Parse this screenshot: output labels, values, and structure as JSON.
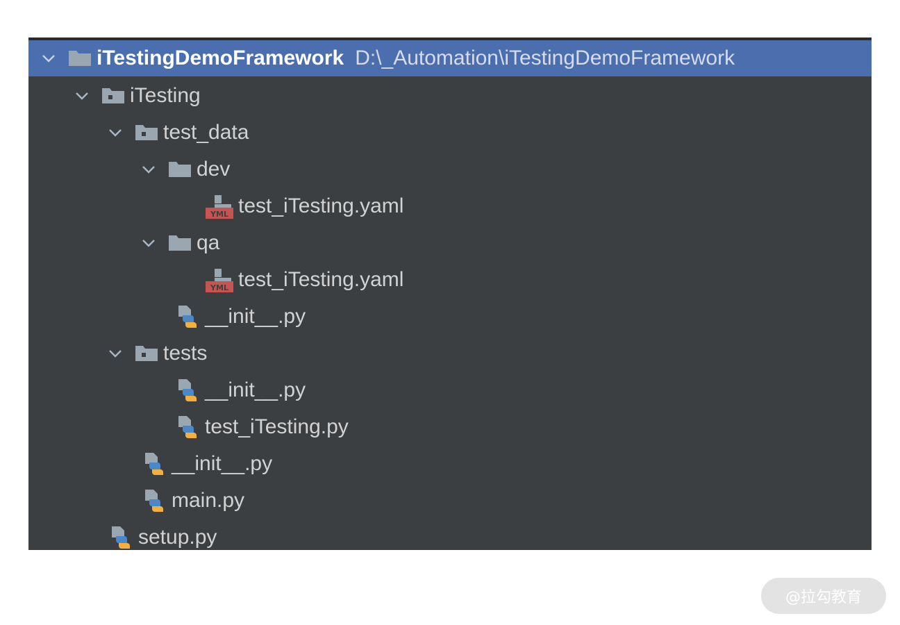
{
  "tree": {
    "root": {
      "label": "iTestingDemoFramework",
      "path": "D:\\_Automation\\iTestingDemoFramework"
    },
    "itesting": {
      "label": "iTesting"
    },
    "test_data": {
      "label": "test_data"
    },
    "dev": {
      "label": "dev"
    },
    "dev_yaml": {
      "label": "test_iTesting.yaml"
    },
    "qa": {
      "label": "qa"
    },
    "qa_yaml": {
      "label": "test_iTesting.yaml"
    },
    "test_data_init": {
      "label": "__init__.py"
    },
    "tests": {
      "label": "tests"
    },
    "tests_init": {
      "label": "__init__.py"
    },
    "tests_file": {
      "label": "test_iTesting.py"
    },
    "itesting_init": {
      "label": "__init__.py"
    },
    "main": {
      "label": "main.py"
    },
    "setup": {
      "label": "setup.py"
    }
  },
  "colors": {
    "panel_bg": "#3c3f41",
    "selection": "#4b6eaf",
    "text": "#d2d2d2",
    "folder": "#9aa7b0",
    "yml_red": "#c75450",
    "py_blue": "#4a88c7",
    "py_yellow": "#f4af3d"
  },
  "icons": {
    "expanded_arrow": "chevron-down-icon",
    "folder": "folder-icon",
    "package": "package-folder-icon",
    "python_file": "python-file-icon",
    "yaml_file": "yaml-file-icon"
  },
  "watermark": {
    "text": "@拉勾教育"
  }
}
